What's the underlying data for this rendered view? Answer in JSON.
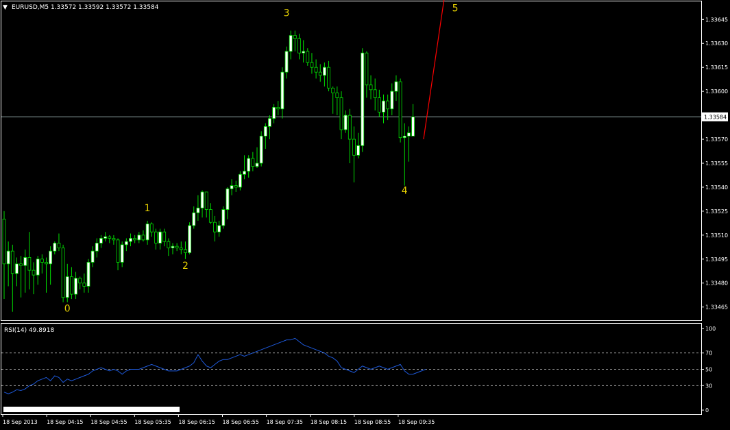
{
  "header": {
    "symbol_info": "EURUSD,M5  1.33572 1.33592 1.33572 1.33584",
    "current_price": "1.33584"
  },
  "colors": {
    "background": "#000000",
    "frame": "#ffffff",
    "bull_body": "#ffffff",
    "candle_outline": "#00e000",
    "bear_body": "#000000",
    "price_line": "#b0c8c8",
    "wave_label": "#e6d000",
    "trend_line": "#ff0000",
    "rsi_line": "#1e5adc",
    "rsi_levels": "#c8c8c8"
  },
  "chart_data": [
    {
      "type": "candlestick",
      "title": "EURUSD,M5",
      "ylim": [
        1.33458,
        1.33655
      ],
      "y_ticks": [
        "1.33645",
        "1.33630",
        "1.33615",
        "1.33600",
        "1.33585",
        "1.33570",
        "1.33555",
        "1.33540",
        "1.33525",
        "1.33510",
        "1.33495",
        "1.33480",
        "1.33465"
      ],
      "current_price": 1.33584,
      "candles": [
        [
          1.3352,
          1.33525,
          1.3347,
          1.33492
        ],
        [
          1.33492,
          1.33506,
          1.33478,
          1.335
        ],
        [
          1.335,
          1.33504,
          1.33462,
          1.33486
        ],
        [
          1.33486,
          1.33496,
          1.33478,
          1.33492
        ],
        [
          1.33492,
          1.33497,
          1.33471,
          1.33491
        ],
        [
          1.33491,
          1.33501,
          1.33474,
          1.33496
        ],
        [
          1.33496,
          1.33512,
          1.33476,
          1.33488
        ],
        [
          1.33488,
          1.33493,
          1.33473,
          1.33485
        ],
        [
          1.33485,
          1.33497,
          1.33479,
          1.33495
        ],
        [
          1.33495,
          1.33498,
          1.33486,
          1.33493
        ],
        [
          1.33493,
          1.33496,
          1.33474,
          1.33492
        ],
        [
          1.33492,
          1.33503,
          1.33479,
          1.335
        ],
        [
          1.335,
          1.33506,
          1.33498,
          1.33505
        ],
        [
          1.33505,
          1.33511,
          1.335,
          1.33502
        ],
        [
          1.33502,
          1.33504,
          1.33468,
          1.33471
        ],
        [
          1.33471,
          1.33492,
          1.33468,
          1.33484
        ],
        [
          1.33484,
          1.3349,
          1.3347,
          1.33473
        ],
        [
          1.33473,
          1.33487,
          1.3347,
          1.33483
        ],
        [
          1.33483,
          1.33484,
          1.33476,
          1.3348
        ],
        [
          1.3348,
          1.33486,
          1.33474,
          1.33478
        ],
        [
          1.33478,
          1.33495,
          1.33474,
          1.33493
        ],
        [
          1.33493,
          1.33503,
          1.3349,
          1.335
        ],
        [
          1.335,
          1.33508,
          1.33496,
          1.33505
        ],
        [
          1.33505,
          1.3351,
          1.33502,
          1.33508
        ],
        [
          1.33508,
          1.33512,
          1.33506,
          1.33509
        ],
        [
          1.33509,
          1.3351,
          1.33505,
          1.33508
        ],
        [
          1.33508,
          1.3351,
          1.33504,
          1.33507
        ],
        [
          1.33507,
          1.33508,
          1.33488,
          1.33493
        ],
        [
          1.33493,
          1.33506,
          1.3349,
          1.33504
        ],
        [
          1.33504,
          1.33508,
          1.335,
          1.33506
        ],
        [
          1.33506,
          1.33511,
          1.33503,
          1.33508
        ],
        [
          1.33508,
          1.3351,
          1.33505,
          1.33507
        ],
        [
          1.33507,
          1.33512,
          1.33505,
          1.3351
        ],
        [
          1.3351,
          1.33513,
          1.33506,
          1.33507
        ],
        [
          1.33507,
          1.33519,
          1.33504,
          1.33517
        ],
        [
          1.33517,
          1.33518,
          1.33509,
          1.33512
        ],
        [
          1.33512,
          1.33514,
          1.33501,
          1.33505
        ],
        [
          1.33505,
          1.33514,
          1.33501,
          1.33512
        ],
        [
          1.33512,
          1.33514,
          1.33503,
          1.33506
        ],
        [
          1.33506,
          1.33508,
          1.33497,
          1.33502
        ],
        [
          1.33502,
          1.33505,
          1.33498,
          1.33503
        ],
        [
          1.33503,
          1.33505,
          1.335,
          1.33502
        ],
        [
          1.33502,
          1.33506,
          1.33498,
          1.33501
        ],
        [
          1.33501,
          1.33506,
          1.33495,
          1.33499
        ],
        [
          1.33499,
          1.33518,
          1.33498,
          1.33516
        ],
        [
          1.33516,
          1.33528,
          1.33514,
          1.33524
        ],
        [
          1.33524,
          1.33535,
          1.33519,
          1.33527
        ],
        [
          1.33527,
          1.33538,
          1.33521,
          1.33537
        ],
        [
          1.33537,
          1.33532,
          1.33521,
          1.33526
        ],
        [
          1.33526,
          1.3353,
          1.33517,
          1.33518
        ],
        [
          1.33518,
          1.33522,
          1.33506,
          1.33512
        ],
        [
          1.33512,
          1.33519,
          1.33509,
          1.33516
        ],
        [
          1.33516,
          1.33528,
          1.33514,
          1.33526
        ],
        [
          1.33526,
          1.3354,
          1.3352,
          1.33539
        ],
        [
          1.33539,
          1.33545,
          1.33535,
          1.33541
        ],
        [
          1.33541,
          1.33544,
          1.33537,
          1.3354
        ],
        [
          1.3354,
          1.3355,
          1.33538,
          1.33548
        ],
        [
          1.33548,
          1.3356,
          1.33545,
          1.3355
        ],
        [
          1.3355,
          1.3356,
          1.33546,
          1.33558
        ],
        [
          1.33558,
          1.33562,
          1.3355,
          1.33553
        ],
        [
          1.33553,
          1.33565,
          1.33552,
          1.33555
        ],
        [
          1.33555,
          1.33575,
          1.33553,
          1.33572
        ],
        [
          1.33572,
          1.3358,
          1.33564,
          1.33578
        ],
        [
          1.33578,
          1.33585,
          1.3357,
          1.33583
        ],
        [
          1.33583,
          1.33592,
          1.3358,
          1.3359
        ],
        [
          1.3359,
          1.33594,
          1.33585,
          1.33589
        ],
        [
          1.33589,
          1.33615,
          1.33583,
          1.33612
        ],
        [
          1.33612,
          1.33628,
          1.33608,
          1.33625
        ],
        [
          1.33625,
          1.33638,
          1.3362,
          1.33635
        ],
        [
          1.33635,
          1.33638,
          1.33625,
          1.33633
        ],
        [
          1.33633,
          1.33636,
          1.3362,
          1.33624
        ],
        [
          1.33624,
          1.33632,
          1.33618,
          1.33625
        ],
        [
          1.33625,
          1.33627,
          1.33616,
          1.33618
        ],
        [
          1.33618,
          1.33624,
          1.33611,
          1.33615
        ],
        [
          1.33615,
          1.3362,
          1.33608,
          1.33612
        ],
        [
          1.33612,
          1.33617,
          1.33606,
          1.3361
        ],
        [
          1.3361,
          1.33618,
          1.33603,
          1.33615
        ],
        [
          1.33615,
          1.33619,
          1.336,
          1.33602
        ],
        [
          1.33602,
          1.33603,
          1.33586,
          1.33599
        ],
        [
          1.33599,
          1.33603,
          1.33585,
          1.33596
        ],
        [
          1.33596,
          1.336,
          1.3357,
          1.33576
        ],
        [
          1.33576,
          1.33588,
          1.33574,
          1.33585
        ],
        [
          1.33585,
          1.33589,
          1.33555,
          1.3357
        ],
        [
          1.3357,
          1.33578,
          1.33543,
          1.3356
        ],
        [
          1.3356,
          1.33574,
          1.33558,
          1.33566
        ],
        [
          1.33566,
          1.33627,
          1.33562,
          1.33624
        ],
        [
          1.33624,
          1.33625,
          1.33596,
          1.33604
        ],
        [
          1.33604,
          1.3361,
          1.33595,
          1.33601
        ],
        [
          1.33601,
          1.33608,
          1.33588,
          1.33596
        ],
        [
          1.33596,
          1.33601,
          1.33584,
          1.33587
        ],
        [
          1.33587,
          1.33598,
          1.3358,
          1.33594
        ],
        [
          1.33594,
          1.33598,
          1.33582,
          1.33589
        ],
        [
          1.33589,
          1.33605,
          1.33585,
          1.336
        ],
        [
          1.336,
          1.3361,
          1.33594,
          1.33606
        ],
        [
          1.33606,
          1.33608,
          1.33568,
          1.33571
        ],
        [
          1.33571,
          1.3358,
          1.33541,
          1.33572
        ],
        [
          1.33572,
          1.33578,
          1.33556,
          1.33574
        ],
        [
          1.33572,
          1.33592,
          1.33572,
          1.33584
        ]
      ],
      "wave_labels": [
        {
          "text": "0",
          "index": 15,
          "price": 1.33462
        },
        {
          "text": "1",
          "index": 34,
          "price": 1.33525
        },
        {
          "text": "2",
          "index": 43,
          "price": 1.33489
        },
        {
          "text": "3",
          "index": 67,
          "price": 1.33647
        },
        {
          "text": "4",
          "index": 95,
          "price": 1.33536
        },
        {
          "text": "5",
          "index": 107,
          "price": 1.3365
        }
      ],
      "trend_line": {
        "from": {
          "index": 99.5,
          "price": 1.3357
        },
        "to": {
          "index": 104.5,
          "price": 1.3366
        }
      }
    },
    {
      "type": "line",
      "title": "RSI(14) 49.8918",
      "ylim": [
        0,
        100
      ],
      "y_ticks": [
        "100",
        "70",
        "50",
        "30",
        "0"
      ],
      "levels": [
        70,
        50,
        30
      ],
      "values": [
        22,
        20,
        22,
        25,
        24,
        26,
        30,
        32,
        36,
        38,
        40,
        36,
        42,
        40,
        34,
        38,
        36,
        38,
        40,
        42,
        44,
        48,
        50,
        52,
        50,
        48,
        50,
        48,
        44,
        48,
        50,
        50,
        50,
        52,
        54,
        56,
        54,
        52,
        50,
        48,
        48,
        48,
        50,
        52,
        54,
        58,
        68,
        60,
        54,
        52,
        56,
        60,
        62,
        62,
        64,
        66,
        68,
        66,
        68,
        70,
        72,
        74,
        76,
        78,
        80,
        82,
        84,
        86,
        86,
        88,
        84,
        80,
        78,
        76,
        74,
        72,
        70,
        66,
        64,
        60,
        52,
        50,
        48,
        46,
        50,
        54,
        52,
        50,
        52,
        54,
        52,
        50,
        52,
        54,
        56,
        48,
        44,
        44,
        46,
        48,
        50
      ],
      "final_value": 49.8918
    }
  ],
  "time_axis": {
    "labels": [
      "18 Sep 2013",
      "18 Sep 04:15",
      "18 Sep 04:55",
      "18 Sep 05:35",
      "18 Sep 06:15",
      "18 Sep 06:55",
      "18 Sep 07:35",
      "18 Sep 08:15",
      "18 Sep 08:55",
      "18 Sep 09:35"
    ]
  }
}
